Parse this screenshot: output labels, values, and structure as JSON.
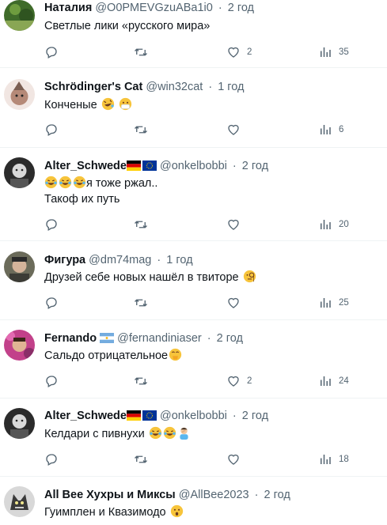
{
  "tweets": [
    {
      "name": "Наталия",
      "handle": "@O0PMEVGzuABa1i0",
      "dot": "·",
      "time": "2 год",
      "text": "Светлые лики «русского мира»",
      "likes": "2",
      "views": "35"
    },
    {
      "name": "Schrödinger's Cat",
      "handle": "@win32cat",
      "dot": "·",
      "time": "1 год",
      "text": "Конченые",
      "emojis": [
        "rolling-laughing-emoji",
        "mask-face-emoji"
      ],
      "likes": "",
      "views": "6"
    },
    {
      "name": "Alter_Schwede",
      "handle": "@onkelbobbi",
      "dot": "·",
      "time": "2 год",
      "text_line1": "я тоже ржал..",
      "text_line2": "Такоф их путь",
      "emojis": [
        "tears-of-joy-emoji",
        "tears-of-joy-emoji",
        "tears-of-joy-emoji"
      ],
      "likes": "",
      "views": "20"
    },
    {
      "name": "Фигура",
      "handle": "@dm74mag",
      "dot": "·",
      "time": "1 год",
      "text": "Друзей себе новых нашёл в твиторе",
      "emojis": [
        "monocle-face-emoji"
      ],
      "likes": "",
      "views": "25"
    },
    {
      "name": "Fernando",
      "handle": "@fernandiniaser",
      "dot": "·",
      "time": "2 год",
      "text": "Сальдо отрицательное",
      "emojis": [
        "hand-over-mouth-emoji"
      ],
      "likes": "2",
      "views": "24"
    },
    {
      "name": "Alter_Schwede",
      "handle": "@onkelbobbi",
      "dot": "·",
      "time": "2 год",
      "text": "Келдари с пивнухи",
      "emojis": [
        "tears-of-joy-emoji",
        "tears-of-joy-emoji",
        "man-facepalming-emoji"
      ],
      "likes": "",
      "views": "18"
    },
    {
      "name": "All Bee Хухры и Миксы",
      "handle": "@AllBee2023",
      "dot": "·",
      "time": "2 год",
      "text": "Гуимплен и Квазимодо",
      "emojis": [
        "hushed-face-emoji"
      ],
      "likes": "",
      "views": ""
    }
  ],
  "colors": {
    "text": "#0f1419",
    "secondary": "#536471",
    "divider": "#eff3f4"
  },
  "icons": [
    "reply-icon",
    "retweet-icon",
    "like-icon",
    "views-icon"
  ]
}
